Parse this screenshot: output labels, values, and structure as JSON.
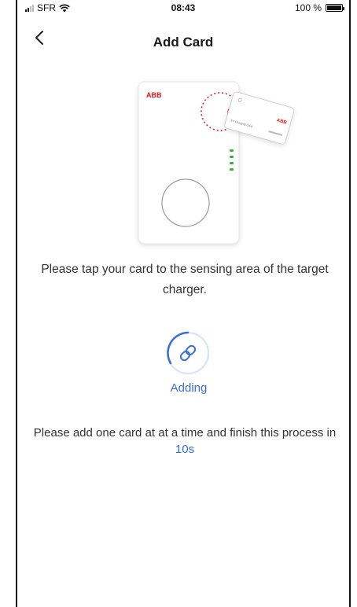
{
  "status_bar": {
    "carrier": "SFR",
    "time": "08:43",
    "battery": "100 %"
  },
  "nav": {
    "title": "Add Card"
  },
  "illustration": {
    "charger_brand": "ABB",
    "card_brand": "ABB",
    "card_label": "EV Charging Card"
  },
  "instruction": "Please tap your card to the sensing area of the target charger.",
  "status": {
    "label": "Adding"
  },
  "notice": {
    "text": "Please add one card at at a time and finish this process in ",
    "time_limit": "10s"
  },
  "colors": {
    "accent": "#3a6fd8",
    "brand_red": "#e8141b",
    "led_green": "#3cb043"
  }
}
